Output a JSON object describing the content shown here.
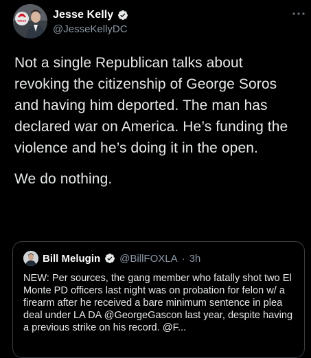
{
  "tweet": {
    "author": {
      "name": "Jesse Kelly",
      "handle": "@JesseKellyDC",
      "avatar_badge_text": "FIRST"
    },
    "body": {
      "paragraph_1": "Not a single Republican talks about revoking the citizenship of George Soros and having him deported. The man has declared war on America. He’s funding the violence and he’s doing it in the open.",
      "paragraph_2": "We do nothing."
    },
    "quoted_tweet": {
      "author_name": "Bill Melugin",
      "handle": "@BillFOXLA",
      "separator": "·",
      "time": "3h",
      "text": "NEW: Per sources, the gang member who fatally shot two El Monte PD officers last night was on probation for felon w/ a firearm after he received a bare minimum sentence in plea deal under LA DA @GeorgeGascon last year, despite having a previous strike on his record. @F..."
    }
  },
  "colors": {
    "background": "#000000",
    "text_primary": "#e7e9ea",
    "text_secondary": "#8b98a5",
    "verified_blue": "#1d9bf0",
    "card_border": "#3a3f44"
  },
  "icons": {
    "verified": "verified-badge-icon",
    "more": "more-options-icon"
  }
}
